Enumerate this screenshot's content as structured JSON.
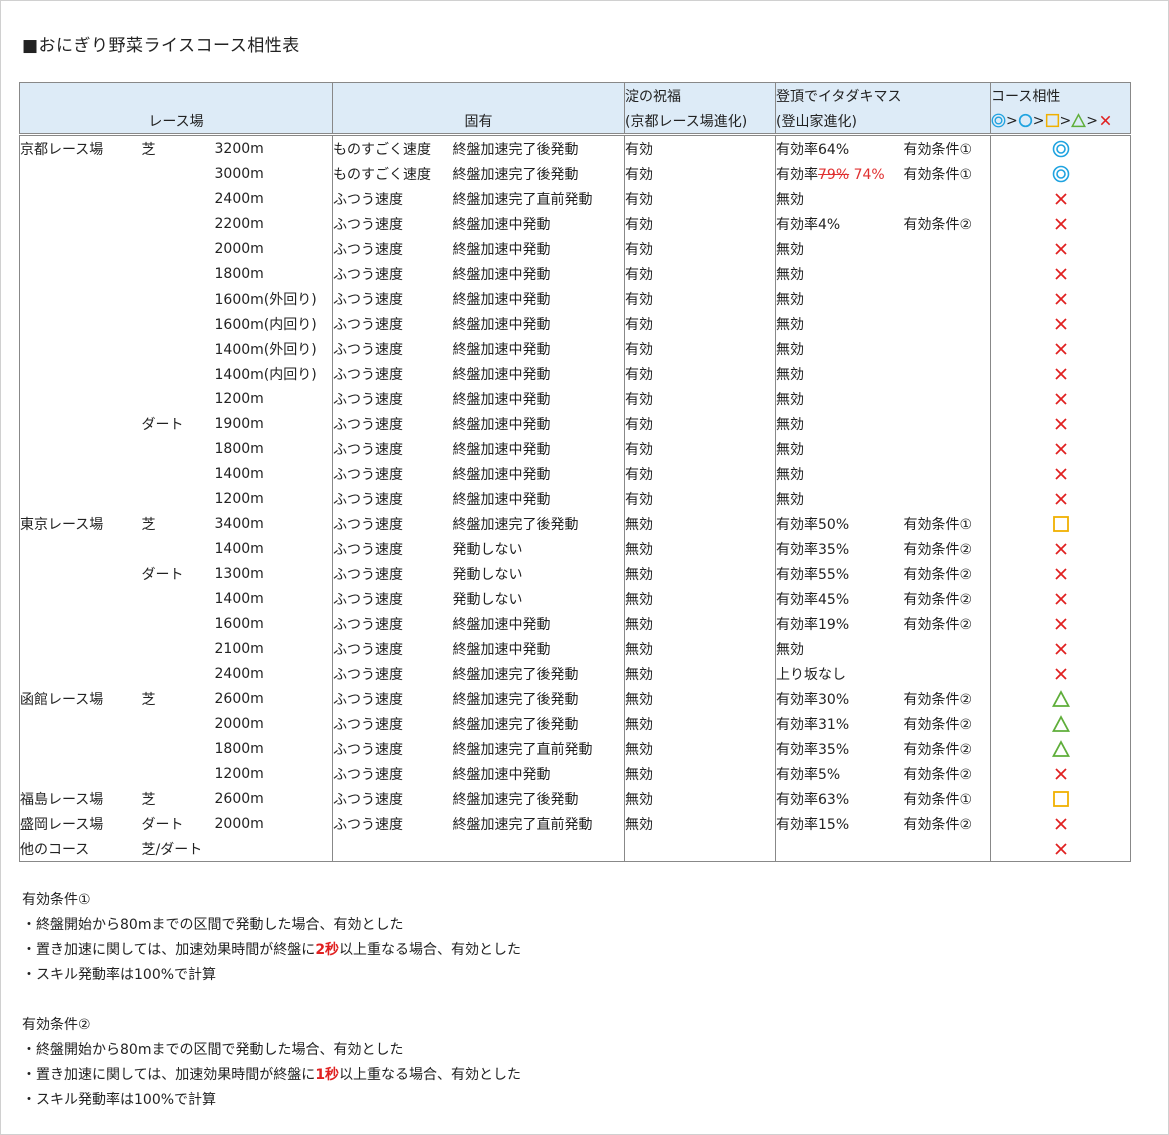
{
  "title": "■おにぎり野菜ライスコース相性表",
  "header": {
    "racecourse": "レース場",
    "unique": "固有",
    "yodo_line1": "淀の祝福",
    "yodo_line2": "(京都レース場進化)",
    "toucho_line1": "登頂でイタダキマス",
    "toucho_line2": "(登山家進化)",
    "compat_line1": "コース相性",
    "legend_separator": ">"
  },
  "colors": {
    "double_circle": "#1fa3e0",
    "circle": "#1fa3e0",
    "square": "#f0b000",
    "triangle": "#5fae3a",
    "cross": "#e02020",
    "header_bg": "#ddebf7",
    "accent_red": "#e03030"
  },
  "rows": [
    {
      "course": "京都レース場",
      "surface": "芝",
      "distance": "3200m",
      "speed": "ものすごく速度",
      "activation": "終盤加速完了後発動",
      "yodo": "有効",
      "toucho": "有効率64%",
      "cond": "有効条件①",
      "mark": "double-circle"
    },
    {
      "course": "",
      "surface": "",
      "distance": "3000m",
      "speed": "ものすごく速度",
      "activation": "終盤加速完了後発動",
      "yodo": "有効",
      "toucho": "有効率",
      "toucho_old": "79%",
      "toucho_new": " 74%",
      "cond": "有効条件①",
      "mark": "double-circle"
    },
    {
      "course": "",
      "surface": "",
      "distance": "2400m",
      "speed": "ふつう速度",
      "activation": "終盤加速完了直前発動",
      "yodo": "有効",
      "toucho": "無効",
      "cond": "",
      "mark": "cross"
    },
    {
      "course": "",
      "surface": "",
      "distance": "2200m",
      "speed": "ふつう速度",
      "activation": "終盤加速中発動",
      "yodo": "有効",
      "toucho": "有効率4%",
      "cond": "有効条件②",
      "mark": "cross"
    },
    {
      "course": "",
      "surface": "",
      "distance": "2000m",
      "speed": "ふつう速度",
      "activation": "終盤加速中発動",
      "yodo": "有効",
      "toucho": "無効",
      "cond": "",
      "mark": "cross"
    },
    {
      "course": "",
      "surface": "",
      "distance": "1800m",
      "speed": "ふつう速度",
      "activation": "終盤加速中発動",
      "yodo": "有効",
      "toucho": "無効",
      "cond": "",
      "mark": "cross"
    },
    {
      "course": "",
      "surface": "",
      "distance": "1600m(外回り)",
      "speed": "ふつう速度",
      "activation": "終盤加速中発動",
      "yodo": "有効",
      "toucho": "無効",
      "cond": "",
      "mark": "cross"
    },
    {
      "course": "",
      "surface": "",
      "distance": "1600m(内回り)",
      "speed": "ふつう速度",
      "activation": "終盤加速中発動",
      "yodo": "有効",
      "toucho": "無効",
      "cond": "",
      "mark": "cross"
    },
    {
      "course": "",
      "surface": "",
      "distance": "1400m(外回り)",
      "speed": "ふつう速度",
      "activation": "終盤加速中発動",
      "yodo": "有効",
      "toucho": "無効",
      "cond": "",
      "mark": "cross"
    },
    {
      "course": "",
      "surface": "",
      "distance": "1400m(内回り)",
      "speed": "ふつう速度",
      "activation": "終盤加速中発動",
      "yodo": "有効",
      "toucho": "無効",
      "cond": "",
      "mark": "cross"
    },
    {
      "course": "",
      "surface": "",
      "distance": "1200m",
      "speed": "ふつう速度",
      "activation": "終盤加速中発動",
      "yodo": "有効",
      "toucho": "無効",
      "cond": "",
      "mark": "cross"
    },
    {
      "course": "",
      "surface": "ダート",
      "distance": "1900m",
      "speed": "ふつう速度",
      "activation": "終盤加速中発動",
      "yodo": "有効",
      "toucho": "無効",
      "cond": "",
      "mark": "cross"
    },
    {
      "course": "",
      "surface": "",
      "distance": "1800m",
      "speed": "ふつう速度",
      "activation": "終盤加速中発動",
      "yodo": "有効",
      "toucho": "無効",
      "cond": "",
      "mark": "cross"
    },
    {
      "course": "",
      "surface": "",
      "distance": "1400m",
      "speed": "ふつう速度",
      "activation": "終盤加速中発動",
      "yodo": "有効",
      "toucho": "無効",
      "cond": "",
      "mark": "cross"
    },
    {
      "course": "",
      "surface": "",
      "distance": "1200m",
      "speed": "ふつう速度",
      "activation": "終盤加速中発動",
      "yodo": "有効",
      "toucho": "無効",
      "cond": "",
      "mark": "cross"
    },
    {
      "course": "東京レース場",
      "surface": "芝",
      "distance": "3400m",
      "speed": "ふつう速度",
      "activation": "終盤加速完了後発動",
      "yodo": "無効",
      "toucho": "有効率50%",
      "cond": "有効条件①",
      "mark": "square"
    },
    {
      "course": "",
      "surface": "",
      "distance": "1400m",
      "speed": "ふつう速度",
      "activation": "発動しない",
      "yodo": "無効",
      "toucho": "有効率35%",
      "cond": "有効条件②",
      "mark": "cross"
    },
    {
      "course": "",
      "surface": "ダート",
      "distance": "1300m",
      "speed": "ふつう速度",
      "activation": "発動しない",
      "yodo": "無効",
      "toucho": "有効率55%",
      "cond": "有効条件②",
      "mark": "cross"
    },
    {
      "course": "",
      "surface": "",
      "distance": "1400m",
      "speed": "ふつう速度",
      "activation": "発動しない",
      "yodo": "無効",
      "toucho": "有効率45%",
      "cond": "有効条件②",
      "mark": "cross"
    },
    {
      "course": "",
      "surface": "",
      "distance": "1600m",
      "speed": "ふつう速度",
      "activation": "終盤加速中発動",
      "yodo": "無効",
      "toucho": "有効率19%",
      "cond": "有効条件②",
      "mark": "cross"
    },
    {
      "course": "",
      "surface": "",
      "distance": "2100m",
      "speed": "ふつう速度",
      "activation": "終盤加速中発動",
      "yodo": "無効",
      "toucho": "無効",
      "cond": "",
      "mark": "cross"
    },
    {
      "course": "",
      "surface": "",
      "distance": "2400m",
      "speed": "ふつう速度",
      "activation": "終盤加速完了後発動",
      "yodo": "無効",
      "toucho": "上り坂なし",
      "cond": "",
      "mark": "cross"
    },
    {
      "course": "函館レース場",
      "surface": "芝",
      "distance": "2600m",
      "speed": "ふつう速度",
      "activation": "終盤加速完了後発動",
      "yodo": "無効",
      "toucho": "有効率30%",
      "cond": "有効条件②",
      "mark": "triangle"
    },
    {
      "course": "",
      "surface": "",
      "distance": "2000m",
      "speed": "ふつう速度",
      "activation": "終盤加速完了後発動",
      "yodo": "無効",
      "toucho": "有効率31%",
      "cond": "有効条件②",
      "mark": "triangle"
    },
    {
      "course": "",
      "surface": "",
      "distance": "1800m",
      "speed": "ふつう速度",
      "activation": "終盤加速完了直前発動",
      "yodo": "無効",
      "toucho": "有効率35%",
      "cond": "有効条件②",
      "mark": "triangle"
    },
    {
      "course": "",
      "surface": "",
      "distance": "1200m",
      "speed": "ふつう速度",
      "activation": "終盤加速中発動",
      "yodo": "無効",
      "toucho": "有効率5%",
      "cond": "有効条件②",
      "mark": "cross"
    },
    {
      "course": "福島レース場",
      "surface": "芝",
      "distance": "2600m",
      "speed": "ふつう速度",
      "activation": "終盤加速完了後発動",
      "yodo": "無効",
      "toucho": "有効率63%",
      "cond": "有効条件①",
      "mark": "square"
    },
    {
      "course": "盛岡レース場",
      "surface": "ダート",
      "distance": "2000m",
      "speed": "ふつう速度",
      "activation": "終盤加速完了直前発動",
      "yodo": "無効",
      "toucho": "有効率15%",
      "cond": "有効条件②",
      "mark": "cross"
    },
    {
      "course": "他のコース",
      "surface": "芝/ダート",
      "distance": "",
      "speed": "",
      "activation": "",
      "yodo": "",
      "toucho": "",
      "cond": "",
      "mark": "cross"
    }
  ],
  "notes": {
    "cond1_title": "有効条件①",
    "cond1_line1": "・終盤開始から80mまでの区間で発動した場合、有効とした",
    "cond1_line2_pre": "・置き加速に関しては、加速効果時間が終盤に",
    "cond1_line2_em": "2秒",
    "cond1_line2_post": "以上重なる場合、有効とした",
    "cond1_line3": "・スキル発動率は100%で計算",
    "cond2_title": "有効条件②",
    "cond2_line1": "・終盤開始から80mまでの区間で発動した場合、有効とした",
    "cond2_line2_pre": "・置き加速に関しては、加速効果時間が終盤に",
    "cond2_line2_em": "1秒",
    "cond2_line2_post": "以上重なる場合、有効とした",
    "cond2_line3": "・スキル発動率は100%で計算"
  }
}
